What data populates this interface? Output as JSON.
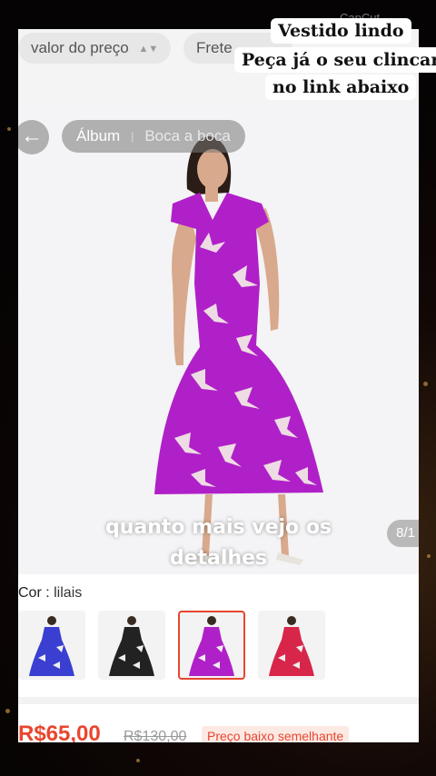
{
  "filters": {
    "price_chip": "valor do preço",
    "shipping_chip": "Frete",
    "sort_icon": "up-down-arrows"
  },
  "viewer": {
    "tabs": [
      "Álbum",
      "Boca a boca"
    ],
    "counter": "8/1",
    "caption_line1": "quanto mais vejo os",
    "caption_line2": "detalhes"
  },
  "product": {
    "color_label": "Cor : ",
    "color_value": "lilais",
    "swatches": [
      {
        "name": "azul",
        "color": "#3a3fd1"
      },
      {
        "name": "preto",
        "color": "#222222"
      },
      {
        "name": "lilas",
        "color": "#b020c8",
        "selected": true
      },
      {
        "name": "vermelho",
        "color": "#d8264a"
      }
    ],
    "price": "R$65,00",
    "old_price": "R$130,00",
    "badge": "Preço baixo semelhante"
  },
  "overlay": {
    "line1": "Vestido lindo",
    "line2": "Peça já o seu  clincar",
    "line3": "no link abaixo"
  },
  "colors": {
    "accent": "#e8462f",
    "dress": "#b020c8"
  }
}
